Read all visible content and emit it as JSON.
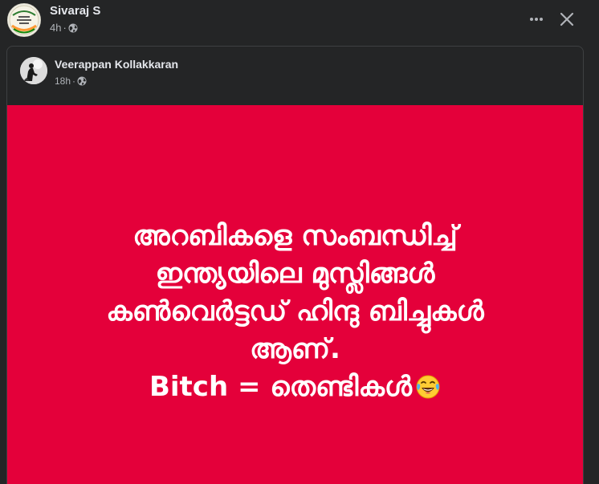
{
  "post": {
    "author": "Sivaraj S",
    "time": "4h",
    "separator": "·",
    "privacy_icon": "globe-icon",
    "actions": {
      "more_icon": "more-horizontal-icon",
      "close_icon": "close-icon"
    }
  },
  "shared_post": {
    "author": "Veerappan Kollakkaran",
    "time": "18h",
    "separator": "·",
    "privacy_icon": "globe-icon",
    "image": {
      "background_color": "#e4003a",
      "text_color": "#ffffff",
      "lines": [
        "അറബികളെ സംബന്ധിച്ച്",
        "ഇന്ത്യയിലെ മുസ്ലിങ്ങൾ",
        "കൺവെർട്ടഡ് ഹിന്ദു ബിച്ചുകൾ",
        "ആണ്.",
        "Bitch = തെണ്ടികൾ"
      ],
      "emoji": "face-with-tears-of-joy-icon"
    }
  },
  "colors": {
    "background": "#242526",
    "text_primary": "#e4e6eb",
    "text_secondary": "#b0b3b8",
    "border": "#3e4042"
  }
}
